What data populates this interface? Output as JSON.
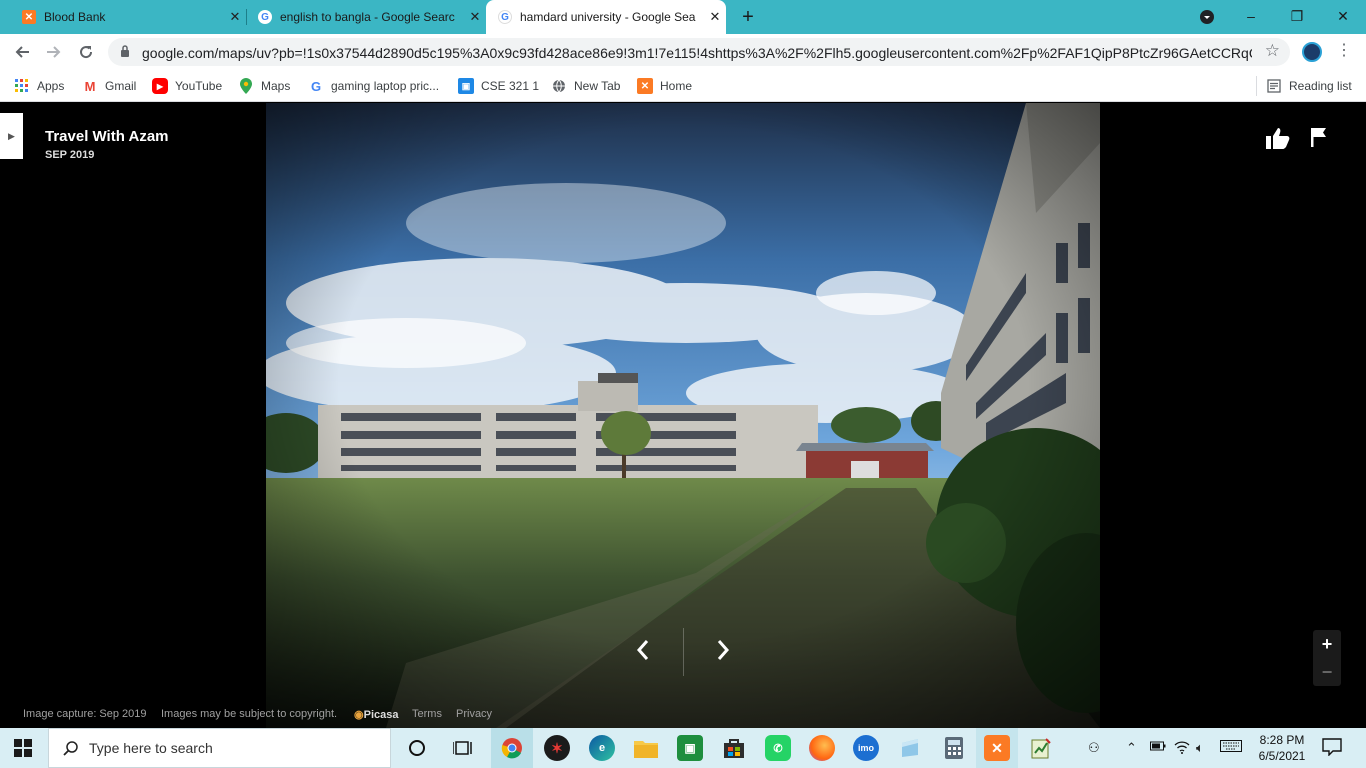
{
  "browser": {
    "tabs": [
      {
        "title": "Blood Bank",
        "icon": "xampp-icon",
        "active": false
      },
      {
        "title": "english to bangla - Google Searc",
        "icon": "google-icon",
        "active": false
      },
      {
        "title": "hamdard university - Google Sea",
        "icon": "google-icon",
        "active": true
      }
    ],
    "new_tab_label": "+",
    "window_controls": {
      "minimize": "–",
      "restore": "❐",
      "close": "✕"
    },
    "url": "google.com/maps/uv?pb=!1s0x37544d2890d5c195%3A0x9c93fd428ace86e9!3m1!7e115!4shttps%3A%2F%2Flh5.googleusercontent.com%2Fp%2FAF1QipP8PtcZr96GAetCCRqQ4...",
    "bookmarks": [
      {
        "label": "Apps",
        "icon": "apps-grid-icon"
      },
      {
        "label": "Gmail",
        "icon": "gmail-icon"
      },
      {
        "label": "YouTube",
        "icon": "youtube-icon"
      },
      {
        "label": "Maps",
        "icon": "maps-pin-icon"
      },
      {
        "label": "gaming laptop pric...",
        "icon": "google-icon"
      },
      {
        "label": "CSE 321 1",
        "icon": "classroom-icon"
      },
      {
        "label": "New Tab",
        "icon": "globe-icon"
      },
      {
        "label": "Home",
        "icon": "xampp-icon"
      }
    ],
    "reading_list": "Reading list"
  },
  "viewer": {
    "author": "Travel With Azam",
    "date": "SEP 2019",
    "footer": {
      "capture": "Image capture: Sep 2019",
      "copyright": "Images may be subject to copyright.",
      "picasa": "Picasa",
      "terms": "Terms",
      "privacy": "Privacy"
    },
    "zoom_in": "+",
    "zoom_out": "−"
  },
  "taskbar": {
    "search_placeholder": "Type here to search",
    "time": "8:28 PM",
    "date": "6/5/2021"
  },
  "colors": {
    "tabstrip": "#3bb6c4",
    "taskbar": "#d9eef4",
    "viewer_bg": "#000000"
  }
}
